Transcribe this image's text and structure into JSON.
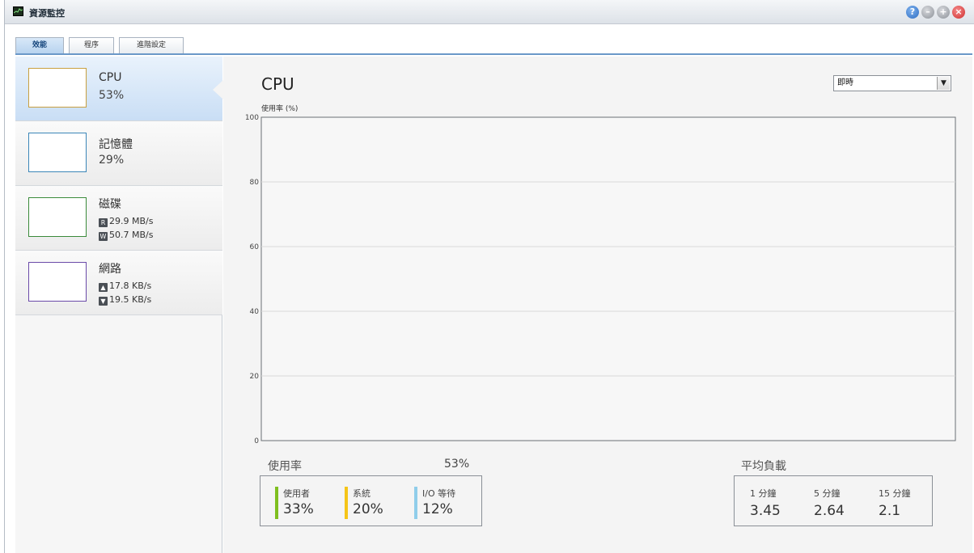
{
  "window": {
    "title": "資源監控",
    "buttons": {
      "help": "?",
      "minimize": "–",
      "maximize": "+",
      "close": "×"
    }
  },
  "tabs": [
    {
      "label": "效能",
      "active": true
    },
    {
      "label": "程序",
      "active": false
    },
    {
      "label": "進階設定",
      "active": false
    }
  ],
  "sidebar": {
    "items": [
      {
        "title": "CPU",
        "value": "53%",
        "color": "#c8a040",
        "selected": true
      },
      {
        "title": "記憶體",
        "value": "29%",
        "color": "#3b86b8",
        "selected": false
      },
      {
        "title": "磁碟",
        "read_badge": "R",
        "read": "29.9 MB/s",
        "write_badge": "W",
        "write": "50.7 MB/s",
        "color": "#3a8a3a",
        "selected": false
      },
      {
        "title": "網路",
        "up_icon": "arrow-up-icon",
        "up": "17.8 KB/s",
        "down_icon": "arrow-down-icon",
        "down": "19.5 KB/s",
        "color": "#6a4aa8",
        "selected": false
      }
    ]
  },
  "main": {
    "title": "CPU",
    "range_select": {
      "value": "即時",
      "options": [
        "即時"
      ]
    }
  },
  "chart_data": {
    "type": "line",
    "title": "",
    "ylabel": "使用率 (%)",
    "xlabel": "",
    "ylim": [
      0,
      100
    ],
    "yticks": [
      0,
      20,
      40,
      60,
      80,
      100
    ],
    "grid": true,
    "series": []
  },
  "usage": {
    "label": "使用率",
    "total": "53%",
    "items": [
      {
        "name": "使用者",
        "value": "33%",
        "color": "#7fbf1f"
      },
      {
        "name": "系統",
        "value": "20%",
        "color": "#f5c518"
      },
      {
        "name": "I/O 等待",
        "value": "12%",
        "color": "#8fcdea"
      }
    ]
  },
  "load_average": {
    "label": "平均負載",
    "items": [
      {
        "name": "1 分鐘",
        "value": "3.45"
      },
      {
        "name": "5 分鐘",
        "value": "2.64"
      },
      {
        "name": "15 分鐘",
        "value": "2.1"
      }
    ]
  }
}
